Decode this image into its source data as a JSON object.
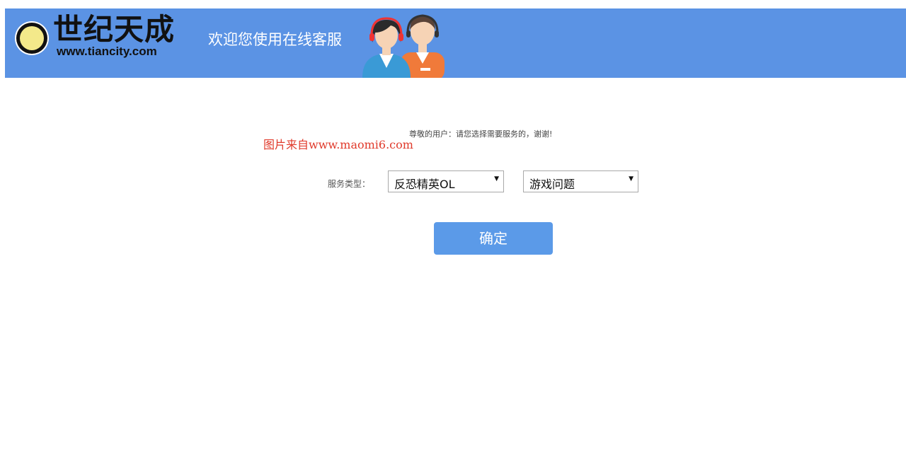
{
  "header": {
    "brand_name": "世纪天成",
    "brand_url": "www.tiancity.com",
    "badge_text": "世纪天成",
    "welcome": "欢迎您使用在线客服",
    "color": "#5b93e4"
  },
  "watermark": "图片来自www.maomi6.com",
  "main": {
    "notice": "尊敬的用户：请您选择需要服务的，谢谢!",
    "service_label": "服务类型：",
    "game_select": {
      "value": "反恐精英OL"
    },
    "issue_select": {
      "value": "游戏问题"
    },
    "confirm_label": "确定",
    "button_color": "#5b9ae8"
  }
}
